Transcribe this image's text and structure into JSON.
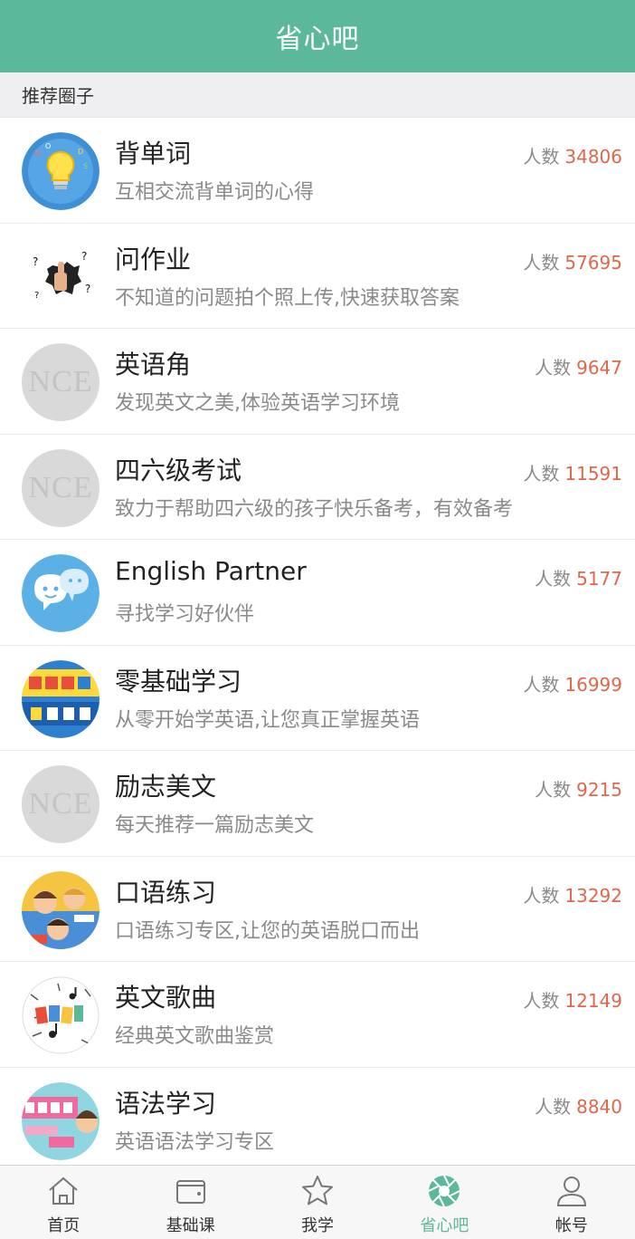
{
  "header": {
    "title": "省心吧"
  },
  "section": {
    "label": "推荐圈子"
  },
  "count_label": "人数",
  "circles": [
    {
      "name": "背单词",
      "desc": "互相交流背单词的心得",
      "count": "34806",
      "avatar": "lightbulb-icon"
    },
    {
      "name": "问作业",
      "desc": "不知道的问题拍个照上传,快速获取答案",
      "count": "57695",
      "avatar": "thumbs-up-icon"
    },
    {
      "name": "英语角",
      "desc": "发现英文之美,体验英语学习环境",
      "count": "9647",
      "avatar": "nce",
      "avatar_text": "NCE"
    },
    {
      "name": "四六级考试",
      "desc": "致力于帮助四六级的孩子快乐备考，有效备考",
      "count": "11591",
      "avatar": "nce",
      "avatar_text": "NCE"
    },
    {
      "name": "English Partner",
      "desc": "寻找学习好伙伴",
      "count": "5177",
      "avatar": "chat-bubbles-icon"
    },
    {
      "name": "零基础学习",
      "desc": "从零开始学英语,让您真正掌握英语",
      "count": "16999",
      "avatar": "zero-basis-icon"
    },
    {
      "name": "励志美文",
      "desc": "每天推荐一篇励志美文",
      "count": "9215",
      "avatar": "nce",
      "avatar_text": "NCE"
    },
    {
      "name": "口语练习",
      "desc": "口语练习专区,让您的英语脱口而出",
      "count": "13292",
      "avatar": "speaking-kids-icon"
    },
    {
      "name": "英文歌曲",
      "desc": "经典英文歌曲鉴赏",
      "count": "12149",
      "avatar": "music-doodle-icon"
    },
    {
      "name": "语法学习",
      "desc": "英语语法学习专区",
      "count": "8840",
      "avatar": "grammar-class-icon"
    }
  ],
  "tabs": [
    {
      "label": "首页",
      "icon": "home-icon",
      "active": false
    },
    {
      "label": "基础课",
      "icon": "wallet-icon",
      "active": false
    },
    {
      "label": "我学",
      "icon": "star-icon",
      "active": false
    },
    {
      "label": "省心吧",
      "icon": "aperture-icon",
      "active": true
    },
    {
      "label": "帐号",
      "icon": "user-icon",
      "active": false
    }
  ],
  "colors": {
    "accent": "#5bb89a",
    "count_number": "#e0674b"
  }
}
